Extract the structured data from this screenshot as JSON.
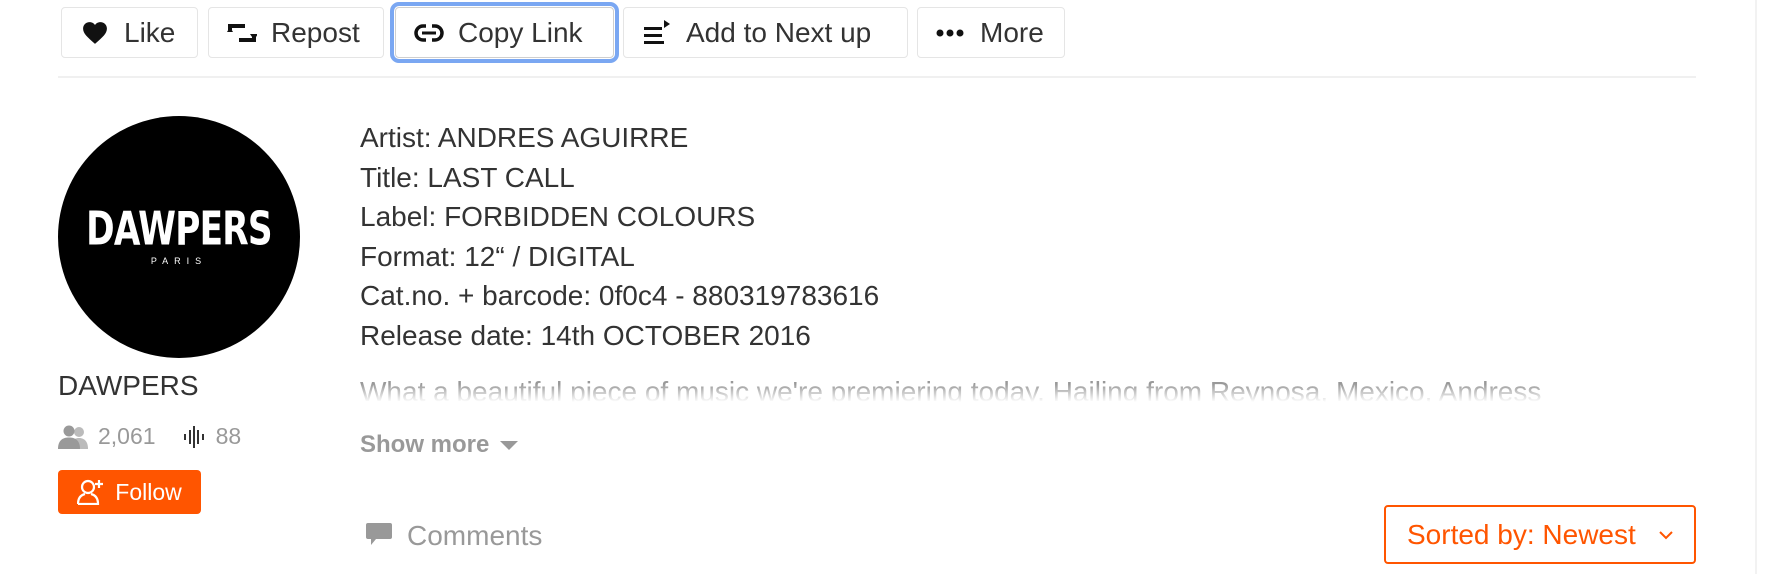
{
  "actions": {
    "like": {
      "label": "Like",
      "icon": "heart-icon"
    },
    "repost": {
      "label": "Repost",
      "icon": "repost-icon"
    },
    "copy_link": {
      "label": "Copy Link",
      "icon": "link-icon",
      "focused": true
    },
    "add_next_up": {
      "label": "Add to Next up",
      "icon": "queue-icon"
    },
    "more": {
      "label": "More",
      "icon": "ellipsis-icon"
    }
  },
  "user": {
    "avatar_text": "DAWPERS",
    "avatar_subtext": "PARIS",
    "name": "DAWPERS",
    "followers": "2,061",
    "tracks": "88",
    "follow_label": "Follow"
  },
  "track_info": {
    "lines": [
      "Artist: ANDRES AGUIRRE",
      "Title: LAST CALL",
      "Label: FORBIDDEN COLOURS",
      "Format: 12“ / DIGITAL",
      "Cat.no. + barcode: 0f0c4 - 880319783616",
      "Release date: 14th OCTOBER 2016"
    ],
    "description": "What a beautiful piece of music we're premiering today.   Hailing from Reynosa, Mexico, Andress",
    "show_more_label": "Show more"
  },
  "comments": {
    "label": "Comments",
    "sort_label": "Sorted by: Newest"
  },
  "colors": {
    "accent": "#ff5500",
    "focus_ring": "#7aa7f2",
    "text": "#333333",
    "muted": "#999999"
  }
}
